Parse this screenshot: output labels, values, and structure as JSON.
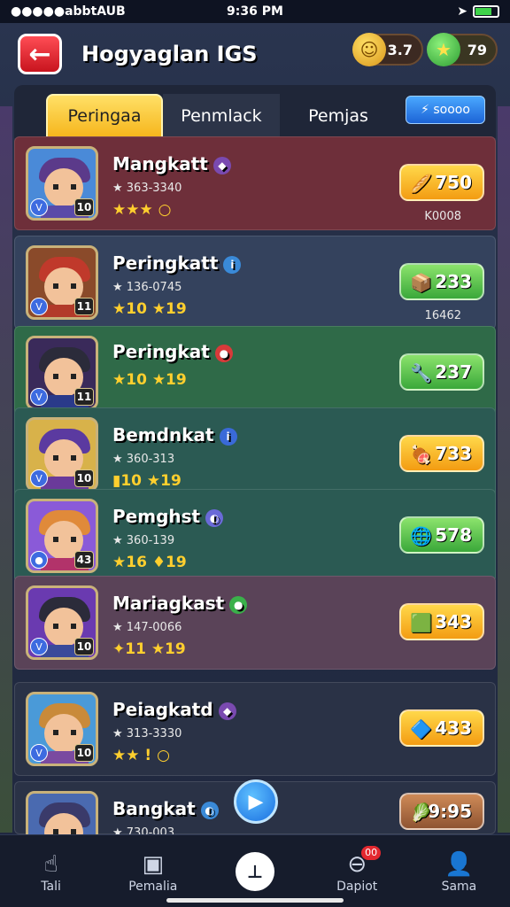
{
  "status": {
    "carrier": "●●●●●abbtAUB",
    "time": "9:36 PM"
  },
  "header": {
    "back_icon": "←",
    "title": "Hogyaglan IGS",
    "coins": "3.7",
    "gems": "79"
  },
  "tabs": [
    "Peringaa",
    "Penmlack",
    "Pemjas"
  ],
  "tab_button": "⚡ soooo",
  "players": [
    {
      "name": "Mangkatt",
      "badge": "◆",
      "sub": "★ 363-3340",
      "stars": "★★★ ○",
      "score": "750",
      "score_sub": "K0008",
      "level": "10",
      "rank": "V",
      "style": "gold",
      "icon": "🥖"
    },
    {
      "name": "Peringkatt",
      "badge": "i",
      "sub": "★ 136-0745",
      "stars": "★10 ★19",
      "score": "233",
      "score_sub": "16462",
      "level": "11",
      "rank": "V",
      "style": "green",
      "icon": "📦"
    },
    {
      "name": "Peringkat",
      "badge": "●",
      "sub": "",
      "stars": "★10 ★19",
      "score": "237",
      "score_sub": "",
      "level": "11",
      "rank": "V",
      "style": "green",
      "icon": "🔧"
    },
    {
      "name": "Bemdnkat",
      "badge": "i",
      "sub": "★ 360-313",
      "stars": "▮10 ★19",
      "score": "733",
      "score_sub": "",
      "level": "10",
      "rank": "V",
      "style": "gold",
      "icon": "🍖"
    },
    {
      "name": "Pemghst",
      "badge": "◐",
      "sub": "★ 360-139",
      "stars": "★16 ♦19",
      "score": "578",
      "score_sub": "",
      "level": "43",
      "rank": "●",
      "style": "green",
      "icon": "🌐"
    },
    {
      "name": "Mariagkast",
      "badge": "●",
      "sub": "★ 147-0066",
      "stars": "✦11 ★19",
      "score": "343",
      "score_sub": "",
      "level": "10",
      "rank": "V",
      "style": "gold",
      "icon": "🟩"
    },
    {
      "name": "Peiagkatd",
      "badge": "◆",
      "sub": "★ 313-3330",
      "stars": "★★ ! ○",
      "score": "433",
      "score_sub": "",
      "level": "10",
      "rank": "V",
      "style": "gold",
      "icon": "🔷"
    },
    {
      "name": "Bangkat",
      "badge": "◐",
      "sub": "★ 730-003",
      "stars": "",
      "score": "9:95",
      "score_sub": "",
      "level": "",
      "rank": "",
      "style": "bronze",
      "icon": "🥬"
    }
  ],
  "nav": [
    {
      "label": "Tali",
      "icon": "☝"
    },
    {
      "label": "Pemalia",
      "icon": "▣"
    },
    {
      "label": "",
      "icon": "⊥"
    },
    {
      "label": "Dapiot",
      "icon": "⊖",
      "badge": "00"
    },
    {
      "label": "Sama",
      "icon": "👤"
    }
  ],
  "colors": {
    "accent": "#f6b61d",
    "row_red": "#6e2f3a",
    "row_blue": "#34425d",
    "row_green": "#2f6a48",
    "row_teal": "#2b5a53",
    "row_mauve": "#5a4358",
    "row_dark": "#2a3246"
  }
}
